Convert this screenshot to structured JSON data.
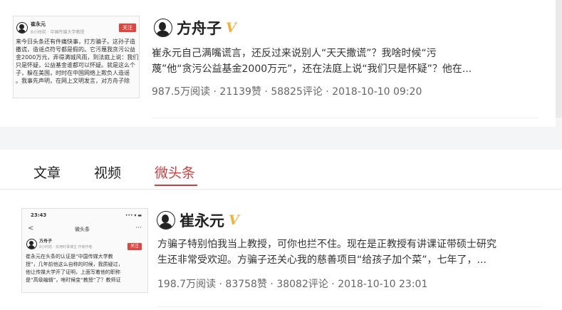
{
  "post1": {
    "thumb": {
      "author": "崔永元",
      "meta": "6小时前 · 中国传媒大学教授",
      "follow": "关注",
      "lines": [
        "来今日头条还有件痛快事，打方骗子。这孙子造",
        "撒谎，造谣点符号都是假的。它污蔑我贪污公益",
        "金2000万元，弄得满城风雨，到法庭上说：我们",
        "只是怀疑，公益基金谁都可以怀疑。就是这么个",
        "子，躲在美国，时时在中国网络上欺负人造谣",
        "。我事先声明，在网上文明发言，对方舟子除"
      ]
    },
    "author": "方舟子",
    "verified": "V",
    "excerpt_line1": "崔永元自己满嘴谎言，还反过来说别人“天天撒谎”？我啥时候“污",
    "excerpt_line2": "蔑”他“贪污公益基金2000万元”，还在法庭上说“我们只是怀疑”？他在...",
    "stats": "987.5万阅读 · 21139赞 · 58825评论 · 2018-10-10 09:20"
  },
  "tabs": {
    "articles": "文章",
    "videos": "视频",
    "weitoutiao": "微头条"
  },
  "post2": {
    "thumb": {
      "time": "23:43",
      "signal": "••• ▾ ▬",
      "back": "<",
      "title": "微头条",
      "more": "···",
      "author": "方舟子",
      "meta": "6小时前 · 实用时事博主 作家作者",
      "follow": "关注",
      "lines": [
        "崔永元在头条的认证是“中国传媒大学教",
        "授”，几年前他这么自称的时候，我质疑过，",
        "他让传媒大学开了证明，上面写着他的职称",
        "是“高级编辑”，啥时候变“教授”了？教师证"
      ]
    },
    "author": "崔永元",
    "verified": "V",
    "excerpt_line1": "方骗子特别怕我当上教授，可你也拦不住。现在是正教授有讲课证带硕士研究",
    "excerpt_line2": "生还非常受欢迎。方骗子还关心我的慈善项目“给孩子加个菜”，七年了，...",
    "stats": "198.7万阅读 · 83758赞 · 38082评论 · 2018-10-10 23:01"
  },
  "colors": {
    "accent": "#d43d3d",
    "verified": "#f2b23a"
  }
}
